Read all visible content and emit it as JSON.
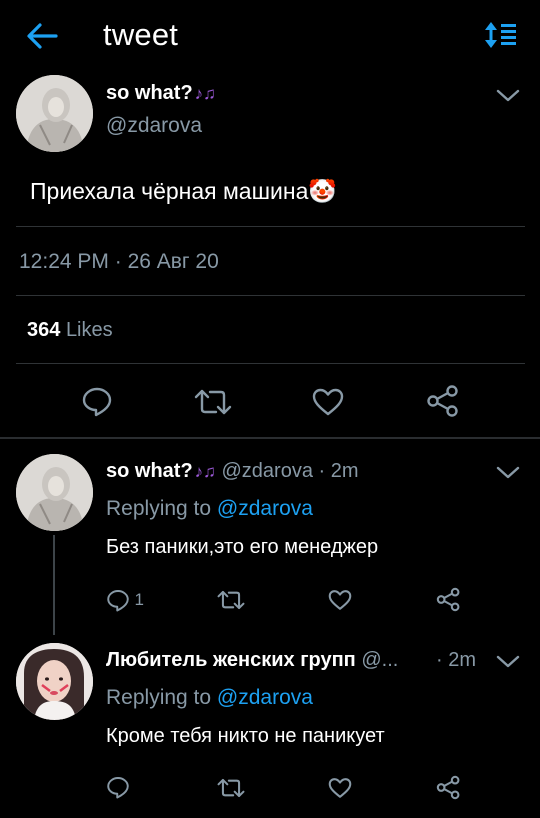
{
  "header": {
    "title": "tweet"
  },
  "tweet": {
    "author_name": "so what?",
    "author_badge": "♪♫",
    "author_handle": "@zdarova",
    "text": "Приехала чёрная машина",
    "text_emoji": "🤡",
    "time": "12:24 PM",
    "date": "26 Авг 20",
    "likes_count": "364",
    "likes_label": "Likes"
  },
  "replies": [
    {
      "author_name": "so what?",
      "author_badge": "♪♫",
      "handle": "@zdarova",
      "time": "2m",
      "replying_prefix": "Replying to",
      "replying_to": "@zdarova",
      "text": "Без паники,это его менеджер",
      "reply_count": "1"
    },
    {
      "author_name": "Любитель женских групп",
      "handle": "@...",
      "time": "2m",
      "replying_prefix": "Replying to",
      "replying_to": "@zdarova",
      "text": "Кроме тебя никто не паникует",
      "reply_count": ""
    }
  ],
  "separator": "·",
  "colors": {
    "accent": "#1da1f2",
    "muted": "#8899a6",
    "background": "#000000",
    "divider": "#2f3336"
  },
  "icons": [
    "back-arrow-icon",
    "sort-icon",
    "chevron-down-icon",
    "reply-icon",
    "retweet-icon",
    "like-icon",
    "share-icon"
  ]
}
